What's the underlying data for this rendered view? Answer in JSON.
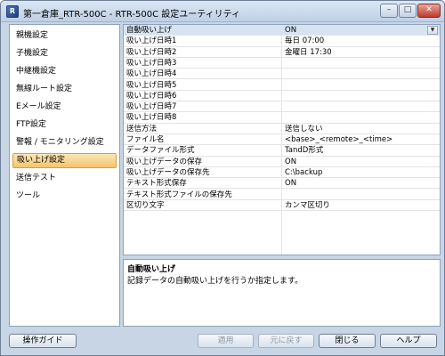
{
  "window": {
    "title": "第一倉庫_RTR-500C - RTR-500C 設定ユーティリティ",
    "icon": "rtr-app-icon",
    "controls": {
      "minimize": "–",
      "maximize": "□",
      "close": "✕"
    }
  },
  "sidebar": {
    "items": [
      {
        "label": "親機設定"
      },
      {
        "label": "子機設定"
      },
      {
        "label": "中継機設定"
      },
      {
        "label": "無線ルート設定"
      },
      {
        "label": "Eメール設定"
      },
      {
        "label": "FTP設定"
      },
      {
        "label": "警報 / モニタリング設定"
      },
      {
        "label": "吸い上げ設定",
        "selected": true
      },
      {
        "label": "送信テスト"
      },
      {
        "label": "ツール"
      }
    ]
  },
  "grid": {
    "rows": [
      {
        "name": "自動吸い上げ",
        "value": "ON",
        "dropdown": true
      },
      {
        "name": "吸い上げ日時1",
        "value": "毎日 07:00"
      },
      {
        "name": "吸い上げ日時2",
        "value": "金曜日 17:30"
      },
      {
        "name": "吸い上げ日時3",
        "value": ""
      },
      {
        "name": "吸い上げ日時4",
        "value": ""
      },
      {
        "name": "吸い上げ日時5",
        "value": ""
      },
      {
        "name": "吸い上げ日時6",
        "value": ""
      },
      {
        "name": "吸い上げ日時7",
        "value": ""
      },
      {
        "name": "吸い上げ日時8",
        "value": ""
      },
      {
        "name": "送信方法",
        "value": "送信しない"
      },
      {
        "name": "ファイル名",
        "value": "<base>_<remote>_<time>"
      },
      {
        "name": "データファイル形式",
        "value": "TandD形式"
      },
      {
        "name": "吸い上げデータの保存",
        "value": "ON"
      },
      {
        "name": "吸い上げデータの保存先",
        "value": "C:\\backup"
      },
      {
        "name": "テキスト形式保存",
        "value": "ON"
      },
      {
        "name": "テキスト形式ファイルの保存先",
        "value": ""
      },
      {
        "name": "区切り文字",
        "value": "カンマ区切り"
      }
    ],
    "dropdown_glyph": "▼"
  },
  "description": {
    "title": "自動吸い上げ",
    "text": "記録データの自動吸い上げを行うか指定します。"
  },
  "buttons": {
    "guide": "操作ガイド",
    "apply": "適用",
    "revert": "元に戻す",
    "close": "閉じる",
    "help": "ヘルプ"
  },
  "colors": {
    "selected_nav": "#f5c46c",
    "selected_row": "#d7e3f0",
    "frame": "#c7d5e4"
  }
}
